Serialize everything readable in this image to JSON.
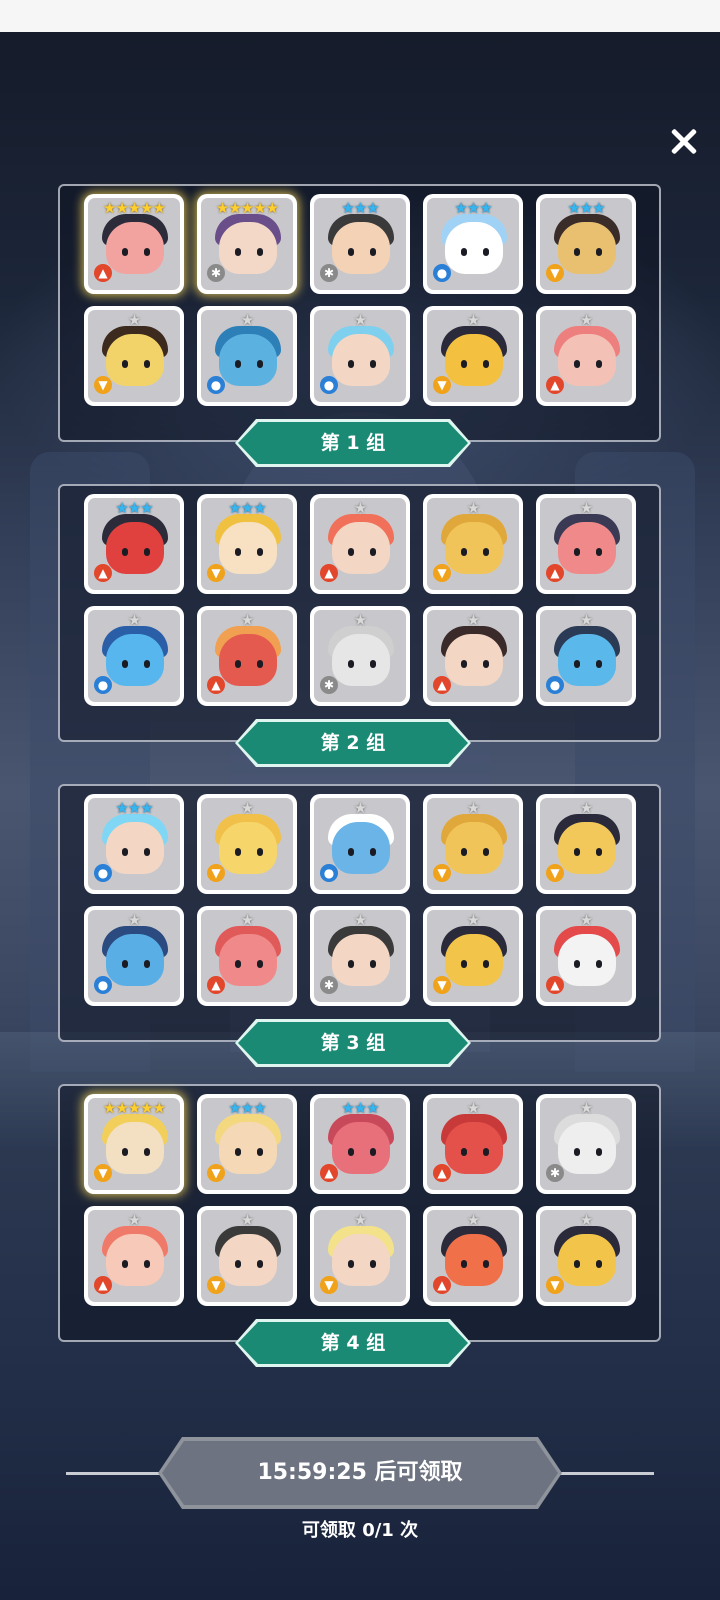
{
  "groups": [
    {
      "label": "第 1 组",
      "cards": [
        {
          "stars": "★★★★★",
          "star_color": "gold",
          "element": "fire",
          "skin": "#f2a3a0",
          "hair": "#2b2b3a",
          "gold": true
        },
        {
          "stars": "★★★★★",
          "star_color": "gold",
          "element": "gear",
          "skin": "#f3d8c8",
          "hair": "#6a4e8a",
          "gold": true
        },
        {
          "stars": "★★★",
          "star_color": "blue",
          "element": "gear",
          "skin": "#f4d2b5",
          "hair": "#3a3a3a",
          "gold": false
        },
        {
          "stars": "★★★",
          "star_color": "blue",
          "element": "water",
          "skin": "#ffffff",
          "hair": "#9fd2f5",
          "gold": false
        },
        {
          "stars": "★★★",
          "star_color": "blue",
          "element": "wind",
          "skin": "#e8c070",
          "hair": "#3a2c28",
          "gold": false
        },
        {
          "stars": "★",
          "star_color": "white",
          "element": "wind",
          "skin": "#f2d36a",
          "hair": "#3c2a1e",
          "gold": false
        },
        {
          "stars": "★",
          "star_color": "white",
          "element": "water",
          "skin": "#5bb2e0",
          "hair": "#2d7fb8",
          "gold": false
        },
        {
          "stars": "★",
          "star_color": "white",
          "element": "water",
          "skin": "#f3d6c3",
          "hair": "#7fd0ef",
          "gold": false
        },
        {
          "stars": "★",
          "star_color": "white",
          "element": "wind",
          "skin": "#f4c040",
          "hair": "#2a2a3a",
          "gold": false
        },
        {
          "stars": "★",
          "star_color": "white",
          "element": "fire",
          "skin": "#f3c1b5",
          "hair": "#ee7f7f",
          "gold": false
        }
      ]
    },
    {
      "label": "第 2 组",
      "cards": [
        {
          "stars": "★★★",
          "star_color": "blue",
          "element": "fire",
          "skin": "#e0413e",
          "hair": "#2b2b3a",
          "gold": false
        },
        {
          "stars": "★★★",
          "star_color": "blue",
          "element": "wind",
          "skin": "#f7e1c2",
          "hair": "#f0c040",
          "gold": false
        },
        {
          "stars": "★",
          "star_color": "white",
          "element": "fire",
          "skin": "#f3d6c3",
          "hair": "#f0705a",
          "gold": false
        },
        {
          "stars": "★",
          "star_color": "white",
          "element": "wind",
          "skin": "#f1c45a",
          "hair": "#e0a83a",
          "gold": false
        },
        {
          "stars": "★",
          "star_color": "white",
          "element": "fire",
          "skin": "#f08a8a",
          "hair": "#3a3a55",
          "gold": false
        },
        {
          "stars": "★",
          "star_color": "white",
          "element": "water",
          "skin": "#58b6ef",
          "hair": "#2a5fa8",
          "gold": false
        },
        {
          "stars": "★",
          "star_color": "white",
          "element": "fire",
          "skin": "#e45a4f",
          "hair": "#f0a050",
          "gold": false
        },
        {
          "stars": "★",
          "star_color": "white",
          "element": "gear",
          "skin": "#e6e6e6",
          "hair": "#cfcfcf",
          "gold": false
        },
        {
          "stars": "★",
          "star_color": "white",
          "element": "fire",
          "skin": "#f3d6c3",
          "hair": "#3a2a2a",
          "gold": false
        },
        {
          "stars": "★",
          "star_color": "white",
          "element": "water",
          "skin": "#5ab8ea",
          "hair": "#2b3a55",
          "gold": false
        }
      ]
    },
    {
      "label": "第 3 组",
      "cards": [
        {
          "stars": "★★★",
          "star_color": "blue",
          "element": "water",
          "skin": "#f3d6c3",
          "hair": "#7fd6f5",
          "gold": false
        },
        {
          "stars": "★",
          "star_color": "white",
          "element": "wind",
          "skin": "#f6d66a",
          "hair": "#f1c04a",
          "gold": false
        },
        {
          "stars": "★",
          "star_color": "white",
          "element": "water",
          "skin": "#6ab4e8",
          "hair": "#ffffff",
          "gold": false
        },
        {
          "stars": "★",
          "star_color": "white",
          "element": "wind",
          "skin": "#f1c45a",
          "hair": "#e0a83a",
          "gold": false
        },
        {
          "stars": "★",
          "star_color": "white",
          "element": "wind",
          "skin": "#f3c85a",
          "hair": "#2a2a3a",
          "gold": false
        },
        {
          "stars": "★",
          "star_color": "white",
          "element": "water",
          "skin": "#5aaee6",
          "hair": "#2a4a80",
          "gold": false
        },
        {
          "stars": "★",
          "star_color": "white",
          "element": "fire",
          "skin": "#f08a8a",
          "hair": "#e05a5a",
          "gold": false
        },
        {
          "stars": "★",
          "star_color": "white",
          "element": "gear",
          "skin": "#f3d6c3",
          "hair": "#3a3a3a",
          "gold": false
        },
        {
          "stars": "★",
          "star_color": "white",
          "element": "wind",
          "skin": "#f2c44a",
          "hair": "#2a2a3a",
          "gold": false
        },
        {
          "stars": "★",
          "star_color": "white",
          "element": "fire",
          "skin": "#f3f3f3",
          "hair": "#e44a4a",
          "gold": false
        }
      ]
    },
    {
      "label": "第 4 组",
      "cards": [
        {
          "stars": "★★★★★",
          "star_color": "gold",
          "element": "wind",
          "skin": "#f3e0c3",
          "hair": "#f1cf5a",
          "gold": true
        },
        {
          "stars": "★★★",
          "star_color": "blue",
          "element": "wind",
          "skin": "#f5d8b5",
          "hair": "#f4d880",
          "gold": false
        },
        {
          "stars": "★★★",
          "star_color": "blue",
          "element": "fire",
          "skin": "#e8707a",
          "hair": "#c84a5a",
          "gold": false
        },
        {
          "stars": "★",
          "star_color": "white",
          "element": "fire",
          "skin": "#e4504a",
          "hair": "#c83a3a",
          "gold": false
        },
        {
          "stars": "★",
          "star_color": "white",
          "element": "gear",
          "skin": "#eeeeee",
          "hair": "#dcdcdc",
          "gold": false
        },
        {
          "stars": "★",
          "star_color": "white",
          "element": "fire",
          "skin": "#f6c9b8",
          "hair": "#f07a6a",
          "gold": false
        },
        {
          "stars": "★",
          "star_color": "white",
          "element": "wind",
          "skin": "#f3d6c3",
          "hair": "#3a3a3a",
          "gold": false
        },
        {
          "stars": "★",
          "star_color": "white",
          "element": "wind",
          "skin": "#f3d6c3",
          "hair": "#f3e28a",
          "gold": false
        },
        {
          "stars": "★",
          "star_color": "white",
          "element": "fire",
          "skin": "#f0704a",
          "hair": "#2a2a3a",
          "gold": false
        },
        {
          "stars": "★",
          "star_color": "white",
          "element": "wind",
          "skin": "#f3c44a",
          "hair": "#2a2a3a",
          "gold": false
        }
      ]
    }
  ],
  "claim": {
    "button_label": "15:59:25 后可领取",
    "count_text": "可领取 0/1 次"
  }
}
